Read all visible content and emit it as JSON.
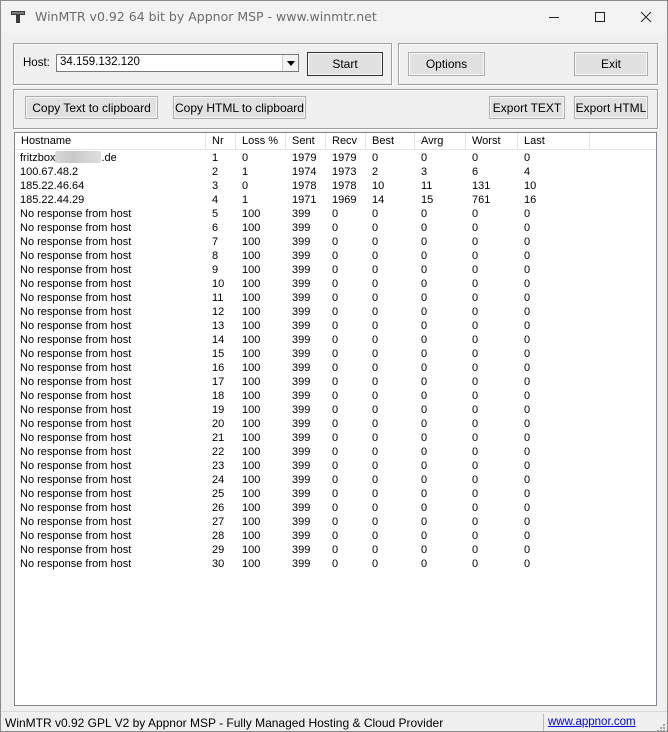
{
  "window": {
    "title": "WinMTR v0.92 64 bit by Appnor MSP - www.winmtr.net"
  },
  "host": {
    "label": "Host:",
    "value": "34.159.132.120"
  },
  "buttons": {
    "start": "Start",
    "options": "Options",
    "exit": "Exit",
    "copy_text": "Copy Text to clipboard",
    "copy_html": "Copy HTML to clipboard",
    "export_text": "Export TEXT",
    "export_html": "Export HTML"
  },
  "table": {
    "columns": [
      "Hostname",
      "Nr",
      "Loss %",
      "Sent",
      "Recv",
      "Best",
      "Avrg",
      "Worst",
      "Last"
    ],
    "rows": [
      {
        "hostname": "fritzbox",
        "hostname_suffix": ".de",
        "nr": "1",
        "loss": "0",
        "sent": "1979",
        "recv": "1979",
        "best": "0",
        "avrg": "0",
        "worst": "0",
        "last": "0"
      },
      {
        "hostname": "100.67.48.2",
        "nr": "2",
        "loss": "1",
        "sent": "1974",
        "recv": "1973",
        "best": "2",
        "avrg": "3",
        "worst": "6",
        "last": "4"
      },
      {
        "hostname": "185.22.46.64",
        "nr": "3",
        "loss": "0",
        "sent": "1978",
        "recv": "1978",
        "best": "10",
        "avrg": "11",
        "worst": "131",
        "last": "10"
      },
      {
        "hostname": "185.22.44.29",
        "nr": "4",
        "loss": "1",
        "sent": "1971",
        "recv": "1969",
        "best": "14",
        "avrg": "15",
        "worst": "761",
        "last": "16"
      },
      {
        "hostname": "No response from host",
        "nr": "5",
        "loss": "100",
        "sent": "399",
        "recv": "0",
        "best": "0",
        "avrg": "0",
        "worst": "0",
        "last": "0"
      },
      {
        "hostname": "No response from host",
        "nr": "6",
        "loss": "100",
        "sent": "399",
        "recv": "0",
        "best": "0",
        "avrg": "0",
        "worst": "0",
        "last": "0"
      },
      {
        "hostname": "No response from host",
        "nr": "7",
        "loss": "100",
        "sent": "399",
        "recv": "0",
        "best": "0",
        "avrg": "0",
        "worst": "0",
        "last": "0"
      },
      {
        "hostname": "No response from host",
        "nr": "8",
        "loss": "100",
        "sent": "399",
        "recv": "0",
        "best": "0",
        "avrg": "0",
        "worst": "0",
        "last": "0"
      },
      {
        "hostname": "No response from host",
        "nr": "9",
        "loss": "100",
        "sent": "399",
        "recv": "0",
        "best": "0",
        "avrg": "0",
        "worst": "0",
        "last": "0"
      },
      {
        "hostname": "No response from host",
        "nr": "10",
        "loss": "100",
        "sent": "399",
        "recv": "0",
        "best": "0",
        "avrg": "0",
        "worst": "0",
        "last": "0"
      },
      {
        "hostname": "No response from host",
        "nr": "11",
        "loss": "100",
        "sent": "399",
        "recv": "0",
        "best": "0",
        "avrg": "0",
        "worst": "0",
        "last": "0"
      },
      {
        "hostname": "No response from host",
        "nr": "12",
        "loss": "100",
        "sent": "399",
        "recv": "0",
        "best": "0",
        "avrg": "0",
        "worst": "0",
        "last": "0"
      },
      {
        "hostname": "No response from host",
        "nr": "13",
        "loss": "100",
        "sent": "399",
        "recv": "0",
        "best": "0",
        "avrg": "0",
        "worst": "0",
        "last": "0"
      },
      {
        "hostname": "No response from host",
        "nr": "14",
        "loss": "100",
        "sent": "399",
        "recv": "0",
        "best": "0",
        "avrg": "0",
        "worst": "0",
        "last": "0"
      },
      {
        "hostname": "No response from host",
        "nr": "15",
        "loss": "100",
        "sent": "399",
        "recv": "0",
        "best": "0",
        "avrg": "0",
        "worst": "0",
        "last": "0"
      },
      {
        "hostname": "No response from host",
        "nr": "16",
        "loss": "100",
        "sent": "399",
        "recv": "0",
        "best": "0",
        "avrg": "0",
        "worst": "0",
        "last": "0"
      },
      {
        "hostname": "No response from host",
        "nr": "17",
        "loss": "100",
        "sent": "399",
        "recv": "0",
        "best": "0",
        "avrg": "0",
        "worst": "0",
        "last": "0"
      },
      {
        "hostname": "No response from host",
        "nr": "18",
        "loss": "100",
        "sent": "399",
        "recv": "0",
        "best": "0",
        "avrg": "0",
        "worst": "0",
        "last": "0"
      },
      {
        "hostname": "No response from host",
        "nr": "19",
        "loss": "100",
        "sent": "399",
        "recv": "0",
        "best": "0",
        "avrg": "0",
        "worst": "0",
        "last": "0"
      },
      {
        "hostname": "No response from host",
        "nr": "20",
        "loss": "100",
        "sent": "399",
        "recv": "0",
        "best": "0",
        "avrg": "0",
        "worst": "0",
        "last": "0"
      },
      {
        "hostname": "No response from host",
        "nr": "21",
        "loss": "100",
        "sent": "399",
        "recv": "0",
        "best": "0",
        "avrg": "0",
        "worst": "0",
        "last": "0"
      },
      {
        "hostname": "No response from host",
        "nr": "22",
        "loss": "100",
        "sent": "399",
        "recv": "0",
        "best": "0",
        "avrg": "0",
        "worst": "0",
        "last": "0"
      },
      {
        "hostname": "No response from host",
        "nr": "23",
        "loss": "100",
        "sent": "399",
        "recv": "0",
        "best": "0",
        "avrg": "0",
        "worst": "0",
        "last": "0"
      },
      {
        "hostname": "No response from host",
        "nr": "24",
        "loss": "100",
        "sent": "399",
        "recv": "0",
        "best": "0",
        "avrg": "0",
        "worst": "0",
        "last": "0"
      },
      {
        "hostname": "No response from host",
        "nr": "25",
        "loss": "100",
        "sent": "399",
        "recv": "0",
        "best": "0",
        "avrg": "0",
        "worst": "0",
        "last": "0"
      },
      {
        "hostname": "No response from host",
        "nr": "26",
        "loss": "100",
        "sent": "399",
        "recv": "0",
        "best": "0",
        "avrg": "0",
        "worst": "0",
        "last": "0"
      },
      {
        "hostname": "No response from host",
        "nr": "27",
        "loss": "100",
        "sent": "399",
        "recv": "0",
        "best": "0",
        "avrg": "0",
        "worst": "0",
        "last": "0"
      },
      {
        "hostname": "No response from host",
        "nr": "28",
        "loss": "100",
        "sent": "399",
        "recv": "0",
        "best": "0",
        "avrg": "0",
        "worst": "0",
        "last": "0"
      },
      {
        "hostname": "No response from host",
        "nr": "29",
        "loss": "100",
        "sent": "399",
        "recv": "0",
        "best": "0",
        "avrg": "0",
        "worst": "0",
        "last": "0"
      },
      {
        "hostname": "No response from host",
        "nr": "30",
        "loss": "100",
        "sent": "399",
        "recv": "0",
        "best": "0",
        "avrg": "0",
        "worst": "0",
        "last": "0"
      }
    ]
  },
  "status": {
    "text": "WinMTR v0.92 GPL V2 by Appnor MSP - Fully Managed Hosting & Cloud Provider",
    "link": "www.appnor.com"
  },
  "icons": {
    "app": "mtr-app-icon",
    "minimize": "minimize-icon",
    "maximize": "maximize-icon",
    "close": "close-icon",
    "dropdown": "chevron-down-icon",
    "grip": "resize-grip-icon"
  },
  "colors": {
    "link": "#0000ee",
    "title_text": "#6c6c6c",
    "window_bg": "#f0f0f0"
  }
}
